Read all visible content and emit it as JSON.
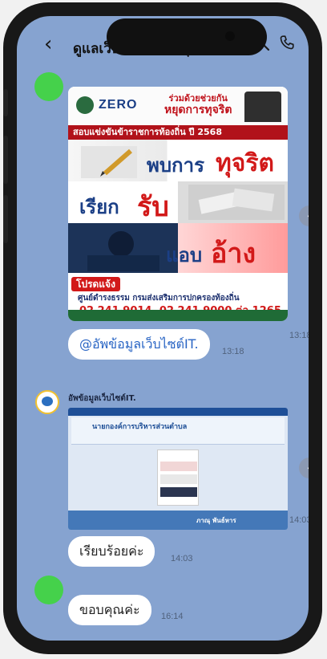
{
  "header": {
    "title": "ดูแลเว็บไซต์ อบต.ชุ...(7)",
    "back_icon": "chevron-left-icon",
    "search_icon": "search-icon",
    "call_icon": "phone-icon"
  },
  "messages": {
    "poster": {
      "zero": "ZERO",
      "slogan_line1": "ร่วมด้วยช่วยกัน",
      "slogan_line2": "หยุดการทุจริต",
      "band": "สอบแข่งขันข้าราชการท้องถิ่น ปี 2568",
      "line1_a": "พบการ",
      "line1_b": "ทุจริต",
      "line2_a": "เรียก",
      "line2_b": "รับ",
      "line3_a": "แอบ",
      "line3_b": "อ้าง",
      "contact_label": "โปรดแจ้ง",
      "center": "ศูนย์ดำรงธรรม กรมส่งเสริมการปกครองท้องถิ่น",
      "phone": "02 241 9014, 02 241 9000 ต่อ 1265",
      "time": "13:18"
    },
    "mention": {
      "text": "@อัพข้อมูลเว็บไซต์IT.",
      "time": "13:18"
    },
    "link_preview": {
      "sender": "อัพข้อมูลเว็บไซต์IT.",
      "site_name": "นายกองค์การบริหารส่วนตำบล",
      "footer_name": "ภาณุ พันธ์หาร",
      "time": "14:03"
    },
    "reply1": {
      "text": "เรียบร้อยค่ะ",
      "time": "14:03"
    },
    "reply2": {
      "text": "ขอบคุณค่ะ",
      "time": "16:14"
    }
  },
  "colors": {
    "chat_bg": "#86a3d0",
    "avatar_green": "#45d14b",
    "accent_red": "#d21919"
  }
}
